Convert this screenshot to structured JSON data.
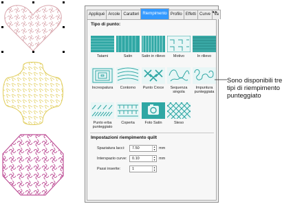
{
  "tabs": [
    "Appliqué",
    "Arcole",
    "Caratteri",
    "Riempimento",
    "Profilo",
    "Effetti",
    "Curve",
    "Va"
  ],
  "tabs_scroll": "◂ ▸",
  "fill_section_title": "Tipo di punto:",
  "stitch_types": [
    {
      "label": "Tatami",
      "icon": "tatami-pattern-icon"
    },
    {
      "label": "Satin",
      "icon": "satin-pattern-icon"
    },
    {
      "label": "Satin in rilievo",
      "icon": "raised-satin-pattern-icon"
    },
    {
      "label": "Motivo",
      "icon": "motif-pattern-icon"
    },
    {
      "label": "In rilievo",
      "icon": "raised-pattern-icon"
    },
    {
      "label": "Increspatura",
      "icon": "ripple-pattern-icon"
    },
    {
      "label": "Contorno",
      "icon": "contour-pattern-icon"
    },
    {
      "label": "Punto Croce",
      "icon": "cross-stitch-pattern-icon"
    },
    {
      "label": "Sequenza singola",
      "icon": "single-sequence-pattern-icon"
    },
    {
      "label": "Impuntura punteggiata",
      "icon": "stipple-pattern-icon"
    },
    {
      "label": "Punto erba punteggiato",
      "icon": "grass-stipple-pattern-icon"
    },
    {
      "label": "Coperta",
      "icon": "blanket-pattern-icon"
    },
    {
      "label": "Foto Satin",
      "icon": "photo-satin-pattern-icon"
    },
    {
      "label": "Steso",
      "icon": "laid-pattern-icon"
    }
  ],
  "quilt_section_title": "Impostazioni riempimento quilt",
  "quilt_params": [
    {
      "label": "Spaziatura lacci:",
      "value": "7.50",
      "unit": "mm"
    },
    {
      "label": "Interspazio curve:",
      "value": "0.10",
      "unit": "mm"
    },
    {
      "label": "Passi inserite:",
      "value": "1",
      "unit": ""
    }
  ],
  "callout_text": "Sono disponibili tre tipi di riempimento punteggiato",
  "colors": {
    "heart": "#d9a6ad",
    "cross": "#e6d36a",
    "hexagon": "#c0559a",
    "accent": "#3399ff",
    "icon_teal": "#2fa7a4"
  }
}
